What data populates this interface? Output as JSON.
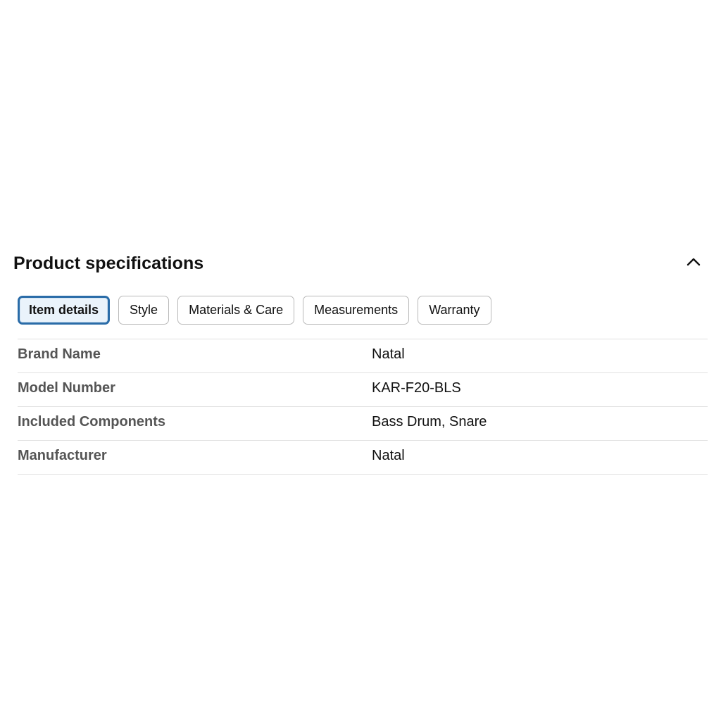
{
  "section": {
    "title": "Product specifications",
    "collapse_icon": "chevron-up-icon"
  },
  "tabs": [
    {
      "label": "Item details",
      "active": true
    },
    {
      "label": "Style",
      "active": false
    },
    {
      "label": "Materials & Care",
      "active": false
    },
    {
      "label": "Measurements",
      "active": false
    },
    {
      "label": "Warranty",
      "active": false
    }
  ],
  "specs": [
    {
      "label": "Brand Name",
      "value": "Natal"
    },
    {
      "label": "Model Number",
      "value": "KAR-F20-BLS"
    },
    {
      "label": "Included Components",
      "value": "Bass Drum, Snare"
    },
    {
      "label": "Manufacturer",
      "value": "Natal"
    }
  ],
  "colors": {
    "active_tab_border": "#2a6ca8",
    "active_tab_bg": "#eaf3fb",
    "label_text": "#555555"
  }
}
